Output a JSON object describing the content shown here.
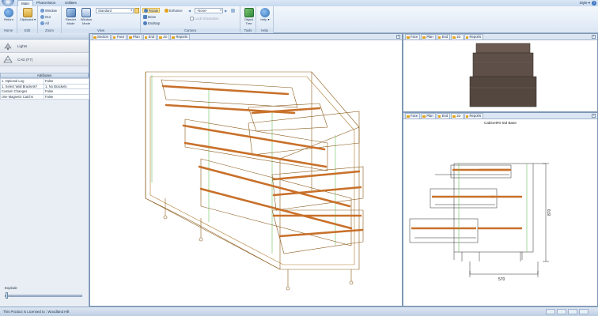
{
  "ribbon_tabs": [
    "Main",
    "PhotoVision",
    "Utilities"
  ],
  "style_menu": "Style",
  "help_glyph": "?",
  "groups": {
    "home": {
      "label": "Home",
      "return_label": "Return"
    },
    "edit": {
      "label": "Edit",
      "clipboard_label": "Clipboard"
    },
    "zoom": {
      "label": "Zoom",
      "window_label": "Window",
      "out_label": "Out",
      "all_label": "All"
    },
    "view": {
      "label": "View",
      "render_mode_label": "Render Mode",
      "window_mode_label": "Window Mode",
      "style_dropdown_value": "Standard"
    },
    "camera": {
      "label": "Camera",
      "rotate_label": "Rotate",
      "move_label": "Move",
      "enhance_label": "Enhance",
      "endstop_label": "Endstop",
      "camera_dropdown_value": "-None-",
      "lock_orientation_label": "Lock Orientation"
    },
    "tools": {
      "label": "Tools",
      "object_tree_label": "Object Tree"
    },
    "help": {
      "label": "Help",
      "help_label": "Help"
    }
  },
  "left_panel": {
    "lights_label": "Lights",
    "cad_label": "CAD (F7)",
    "attributes_title": "Attributes",
    "attributes": [
      {
        "key": "1. Optional Leg",
        "value": "False"
      },
      {
        "key": "1. Select Wall Brackets?",
        "value": "1. No Brackets"
      },
      {
        "key": "Custom Changes",
        "value": "False"
      },
      {
        "key": "Use Magnetic Catchs",
        "value": "False"
      }
    ],
    "explode_label": "Explode"
  },
  "main_view": {
    "tabs": [
      "Section",
      "Face",
      "Plan",
      "End",
      "3D",
      "Reports"
    ],
    "active_tab": "3D"
  },
  "top_right_view": {
    "tabs": [
      "Face",
      "Plan",
      "End",
      "3D",
      "Reports"
    ],
    "active_tab": "3D"
  },
  "bottom_right_view": {
    "tabs": [
      "Face",
      "Plan",
      "End",
      "3D",
      "Reports"
    ],
    "active_tab": "3D",
    "drawing_title": "Cabinet#0 Std Base",
    "dim_height": "870",
    "dim_width": "570"
  },
  "status": {
    "text": "This Product is Licensed to : Woodland Hill"
  },
  "colors": {
    "wire": "#8a5a1a",
    "drawer_orange": "#c8702a",
    "green_line": "#6cbf5a",
    "wood_dark": "#5e5048",
    "ribbon_bg": "#dce7f4"
  }
}
